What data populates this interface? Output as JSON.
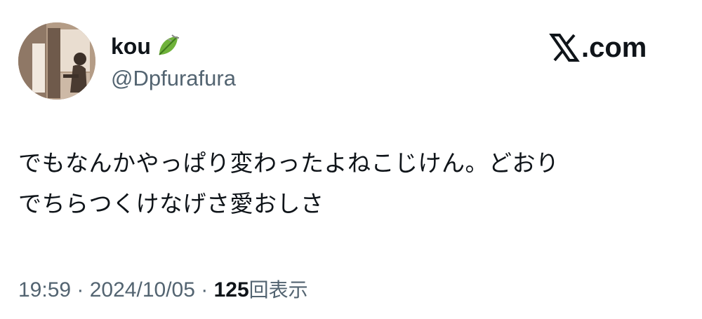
{
  "author": {
    "display_name": "kou",
    "badge_icon": "leaf-icon",
    "handle": "@Dpfurafura"
  },
  "site": {
    "logo_icon": "x-logo-icon",
    "domain": ".com"
  },
  "tweet": {
    "text_lines": [
      "でもなんかやっぱり変わったよねこじけん。どおり",
      "でちらつくけなげさ愛おしさ"
    ]
  },
  "meta": {
    "time": "19:59",
    "separator": " · ",
    "date": "2024/10/05",
    "views_count": "125",
    "views_label": "回表示"
  },
  "colors": {
    "text_primary": "#0f1419",
    "text_secondary": "#536471",
    "leaf_green": "#5a9e2f"
  }
}
